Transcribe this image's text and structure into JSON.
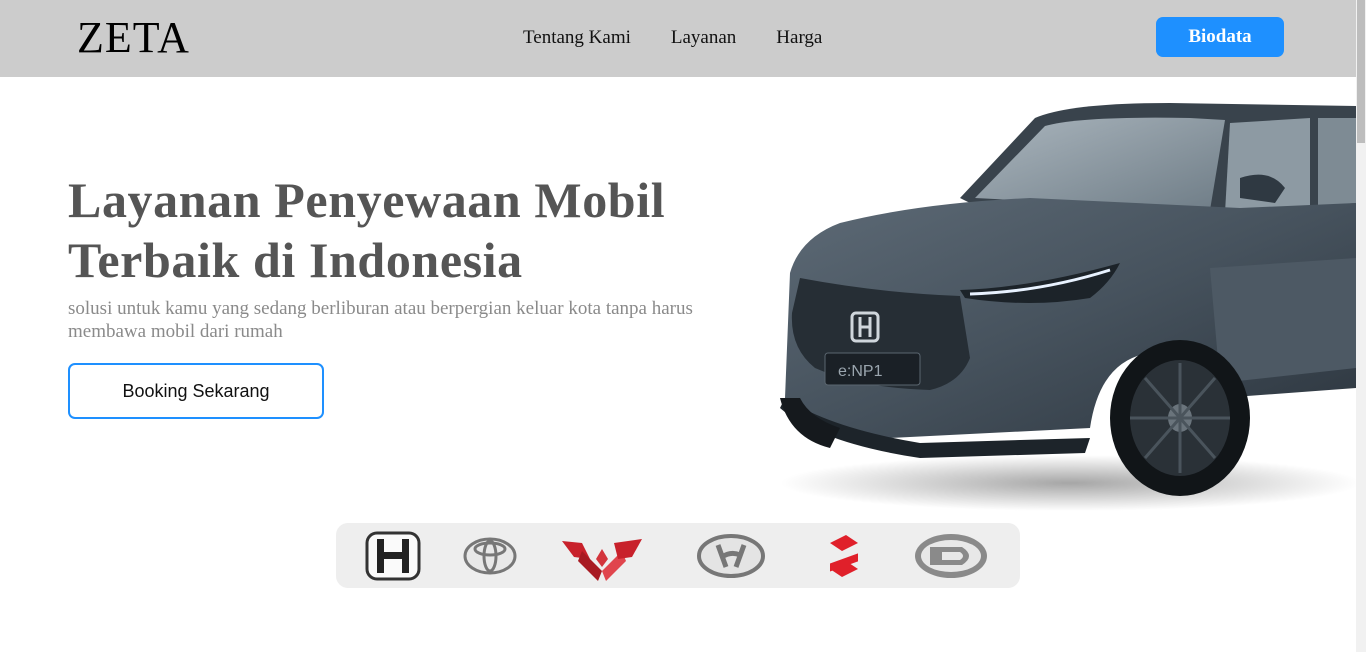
{
  "navbar": {
    "brand": "ZETA",
    "links": [
      "Tentang Kami",
      "Layanan",
      "Harga"
    ],
    "cta_label": "Biodata"
  },
  "hero": {
    "title": "Layanan Penyewaan Mobil Terbaik di Indonesia",
    "subtitle": "solusi untuk kamu yang sedang berliburan atau berpergian keluar kota tanpa harus membawa mobil dari rumah",
    "button_label": "Booking Sekarang",
    "car_badge": "e:NP1"
  },
  "brands": {
    "logos": [
      "honda-logo",
      "toyota-logo",
      "wuling-logo",
      "hyundai-logo",
      "suzuki-logo",
      "daihatsu-logo"
    ]
  },
  "colors": {
    "accent": "#1e90ff",
    "navbar_bg": "#cccccc",
    "title_text": "#555555",
    "subtitle_text": "#8a8a8a",
    "brand_strip_bg": "#eeeeee",
    "car_body": "#4a5661",
    "suzuki_red": "#e0202a",
    "wuling_red": "#c8212b"
  }
}
